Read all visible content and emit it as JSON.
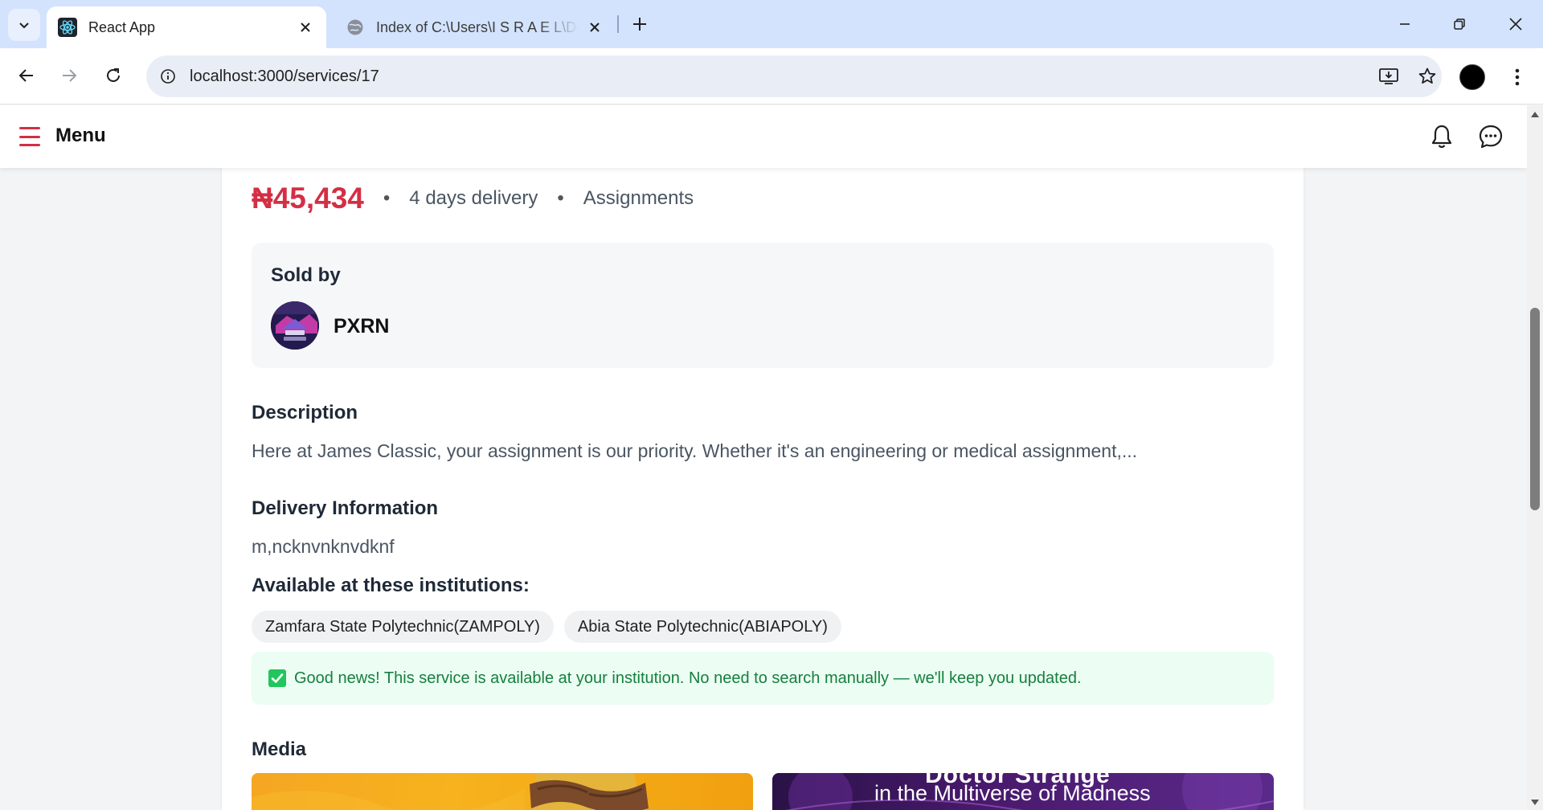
{
  "browser": {
    "tabs": [
      {
        "title": "React App",
        "favicon": "react-icon",
        "active": true
      },
      {
        "title": "Index of C:\\Users\\I S R A E L\\Desktop",
        "favicon": "globe-icon",
        "active": false
      }
    ],
    "url": "localhost:3000/services/17"
  },
  "header": {
    "menu_label": "Menu",
    "icons": [
      "hamburger-icon",
      "bell-icon",
      "chat-icon"
    ],
    "accent_color": "#d32f45"
  },
  "service": {
    "price": "₦45,434",
    "separator": "•",
    "delivery": "4 days delivery",
    "category": "Assignments",
    "seller": {
      "section_label": "Sold by",
      "name": "PXRN"
    },
    "description": {
      "title": "Description",
      "text": "Here at James Classic, your assignment is our priority. Whether it's an engineering or medical assignment,..."
    },
    "delivery_info": {
      "title": "Delivery Information",
      "text": "m,ncknvnknvdknf"
    },
    "institutions": {
      "title": "Available at these institutions:",
      "items": [
        "Zamfara State Polytechnic(ZAMPOLY)",
        "Abia State Polytechnic(ABIAPOLY)"
      ]
    },
    "notice": {
      "text": "Good news! This service is available at your institution. No need to search manually — we'll keep you updated.",
      "color": "#15803d"
    },
    "media": {
      "title": "Media",
      "right_image_title_top": "Doctor Strange",
      "right_image_title": "in the Multiverse of Madness"
    }
  }
}
